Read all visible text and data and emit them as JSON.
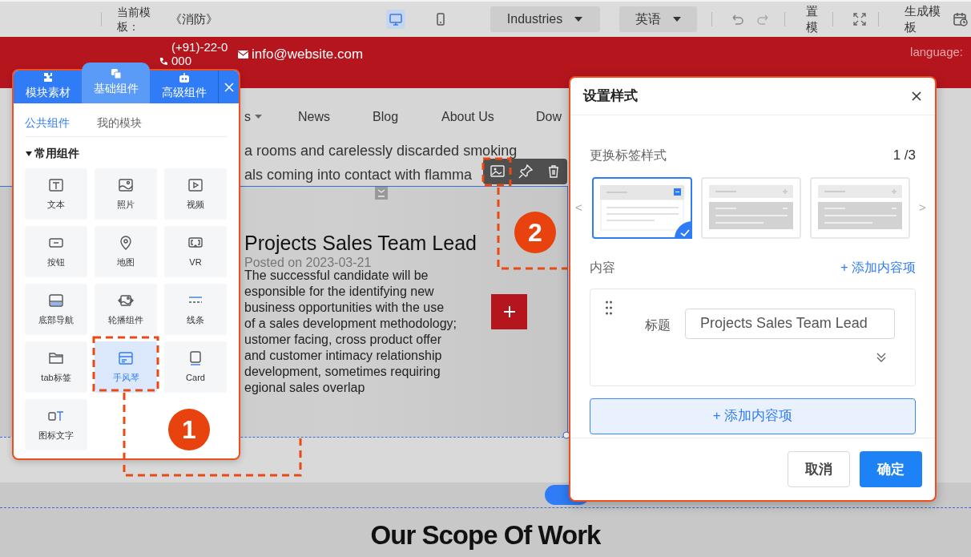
{
  "top_bar": {
    "template_label": "当前模板：",
    "template_name": "《消防》",
    "devices": [
      {
        "kind": "desktop",
        "selected": true
      },
      {
        "kind": "mobile",
        "selected": false
      }
    ],
    "industry": "Industries",
    "language": "英语",
    "cut_label": "置模",
    "generate_label": "生成模板"
  },
  "site_header": {
    "phone": "(+91)-22-0000",
    "email": "info@website.com",
    "language_label": "language:"
  },
  "site_nav": [
    {
      "label": "s",
      "has_menu": true
    },
    {
      "label": "News",
      "has_menu": false
    },
    {
      "label": "Blog",
      "has_menu": false
    },
    {
      "label": "About Us",
      "has_menu": false
    },
    {
      "label": "Dow",
      "has_menu": false
    }
  ],
  "intro_lines": [
    "a rooms and carelessly discarded smoking",
    "als coming into contact with flamma"
  ],
  "article": {
    "title": "Projects Sales Team Lead",
    "posted": "Posted on 2023-03-21",
    "lines": [
      "The successful candidate will be",
      "esponsible for the identifying new",
      "business opportunities with the use",
      "of a sales development methodology;",
      "ustomer facing, cross product offer",
      "and customer intimacy relationship",
      "development, sometimes requiring",
      "egional sales overlap"
    ]
  },
  "section_heading": "Our Scope Of Work",
  "component_panel": {
    "tabs": [
      {
        "label": "模块素材",
        "selected": false
      },
      {
        "label": "基础组件",
        "selected": true
      },
      {
        "label": "高级组件",
        "selected": false
      }
    ],
    "subtabs": [
      {
        "label": "公共组件",
        "selected": true
      },
      {
        "label": "我的模块",
        "selected": false
      }
    ],
    "group": {
      "label": "常用组件",
      "expanded": true
    },
    "items": [
      {
        "label": "文本",
        "selected": false
      },
      {
        "label": "照片",
        "selected": false
      },
      {
        "label": "视频",
        "selected": false
      },
      {
        "label": "按钮",
        "selected": false
      },
      {
        "label": "地图",
        "selected": false
      },
      {
        "label": "VR",
        "selected": false
      },
      {
        "label": "底部导航",
        "selected": false
      },
      {
        "label": "轮播组件",
        "selected": false
      },
      {
        "label": "线条",
        "selected": false
      },
      {
        "label": "tab标签",
        "selected": false
      },
      {
        "label": "手风琴",
        "selected": true
      },
      {
        "label": "Card",
        "selected": false
      },
      {
        "label": "图标文字",
        "selected": false
      }
    ]
  },
  "annotations": [
    {
      "label": "1"
    },
    {
      "label": "2"
    }
  ],
  "style_dialog": {
    "title": "设置样式",
    "style_label": "更换标签样式",
    "page": "1 /3",
    "prev": "<",
    "next": ">",
    "styles": [
      {
        "kind": "plain",
        "selected": true
      },
      {
        "kind": "filled",
        "selected": false
      },
      {
        "kind": "filled",
        "selected": false
      }
    ],
    "content_label": "内容",
    "add_link": "+ 添加内容项",
    "entries": [
      {
        "field_label": "标题",
        "value": "Projects Sales Team Lead"
      }
    ],
    "add_button": "+ 添加内容项",
    "cancel": "取消",
    "ok": "确定"
  }
}
